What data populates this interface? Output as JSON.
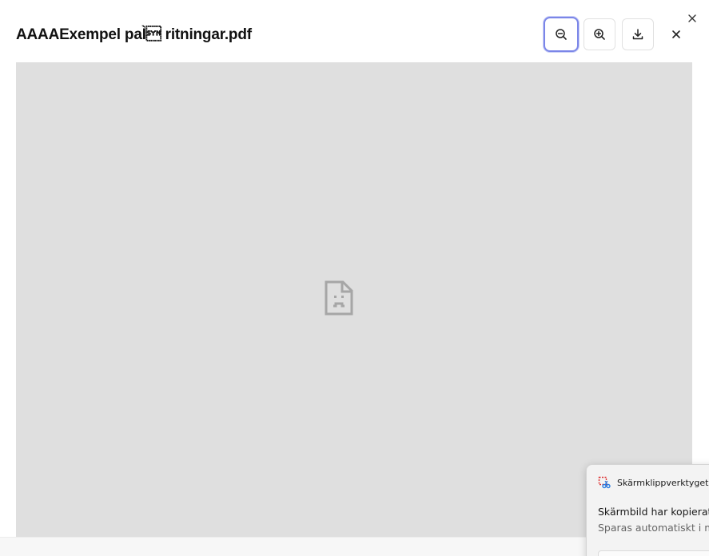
{
  "dialog": {
    "title": "AAAAExempel paÌ\u0016 ritningar.pdf"
  },
  "toolbar": {
    "zoom_out": {
      "icon": "zoom-out-icon",
      "focused": true
    },
    "zoom_in": {
      "icon": "zoom-in-icon"
    },
    "download": {
      "icon": "download-icon"
    },
    "close": {
      "icon": "close-icon"
    }
  },
  "viewer": {
    "state": "broken-document",
    "icon": "sad-document-icon",
    "background": "#dfdfdf"
  },
  "toast": {
    "app_name": "Skärmklippverktyget",
    "title": "Skärmbild har kopierat",
    "subtitle": "Sparas automatiskt i m"
  },
  "colors": {
    "focus_ring": "#7b86e8"
  }
}
